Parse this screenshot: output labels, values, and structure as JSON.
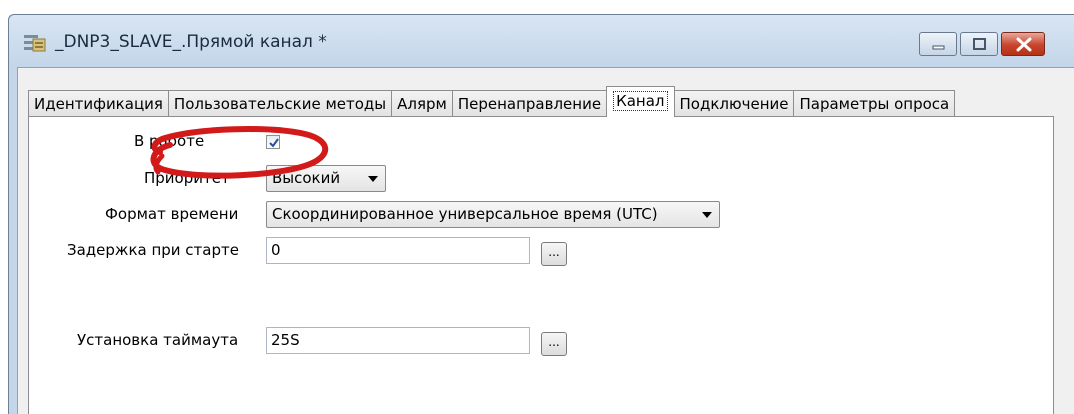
{
  "window": {
    "title": "_DNP3_SLAVE_.Прямой канал *",
    "icon": "properties-window-icon",
    "controls": [
      "minimize-icon",
      "maximize-icon",
      "close-icon"
    ]
  },
  "tabs": [
    {
      "label": "Идентификация",
      "active": false
    },
    {
      "label": "Пользовательские методы",
      "active": false
    },
    {
      "label": "Алярм",
      "active": false
    },
    {
      "label": "Перенаправление",
      "active": false
    },
    {
      "label": "Канал",
      "active": true
    },
    {
      "label": "Подключение",
      "active": false
    },
    {
      "label": "Параметры опроса",
      "active": false
    }
  ],
  "form": {
    "in_service": {
      "label": "В работе",
      "checked": true
    },
    "priority": {
      "label": "Приоритет",
      "value": "Высокий"
    },
    "time_format": {
      "label": "Формат времени",
      "value": "Скоординированное универсальное время (UTC)"
    },
    "start_delay": {
      "label": "Задержка при старте",
      "value": "0",
      "button": "..."
    },
    "timeout": {
      "label": "Установка таймаута",
      "value": "25S",
      "button": "..."
    }
  },
  "colors": {
    "annotation": "#d21a1a",
    "checkmark": "#2a4f9e",
    "close_button": "#c8442c"
  }
}
